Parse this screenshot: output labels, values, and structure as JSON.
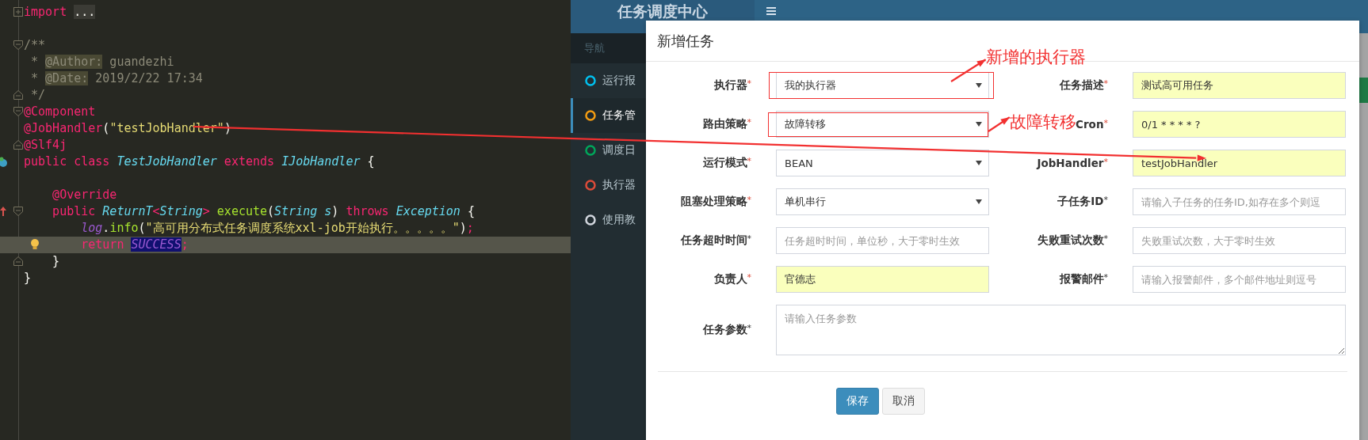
{
  "editor": {
    "lines": [
      {
        "current": false,
        "markers": [
          {
            "kind": "fold-plus"
          }
        ],
        "tokens": [
          {
            "t": "import ",
            "kind": "keyword"
          },
          {
            "t": "...",
            "kind": "folded"
          }
        ]
      },
      {
        "current": false
      },
      {
        "current": false,
        "markers": [
          {
            "kind": "fold-open"
          }
        ],
        "tokens": [
          {
            "t": "/**",
            "kind": "comment"
          }
        ]
      },
      {
        "current": false,
        "tokens": [
          {
            "t": " * ",
            "kind": "comment"
          },
          {
            "t": "@Author:",
            "kind": "doctag"
          },
          {
            "t": " guandezhi",
            "kind": "comment"
          }
        ]
      },
      {
        "current": false,
        "tokens": [
          {
            "t": " * ",
            "kind": "comment"
          },
          {
            "t": "@Date:",
            "kind": "doctag"
          },
          {
            "t": " 2019/2/22 17:34",
            "kind": "comment"
          }
        ]
      },
      {
        "current": false,
        "markers": [
          {
            "kind": "fold-close"
          }
        ],
        "tokens": [
          {
            "t": " */",
            "kind": "comment"
          }
        ]
      },
      {
        "current": false,
        "markers": [
          {
            "kind": "fold-open"
          }
        ],
        "tokens": [
          {
            "t": "@Component",
            "kind": "keyword"
          }
        ]
      },
      {
        "current": false,
        "tokens": [
          {
            "t": "@JobHandler",
            "kind": "keyword"
          },
          {
            "t": "(",
            "kind": "plain"
          },
          {
            "t": "\"testJobHandler\"",
            "kind": "string"
          },
          {
            "t": ")",
            "kind": "plain"
          }
        ]
      },
      {
        "current": false,
        "markers": [
          {
            "kind": "fold-close"
          }
        ],
        "tokens": [
          {
            "t": "@Slf4j",
            "kind": "keyword"
          }
        ]
      },
      {
        "current": false,
        "markers": [
          {
            "kind": "class"
          }
        ],
        "tokens": [
          {
            "t": "public class ",
            "kind": "keyword"
          },
          {
            "t": "TestJobHandler",
            "kind": "type"
          },
          {
            "t": " extends ",
            "kind": "keyword"
          },
          {
            "t": "IJobHandler",
            "kind": "type"
          },
          {
            "t": " {",
            "kind": "plain"
          }
        ]
      },
      {
        "current": false
      },
      {
        "current": false,
        "tokens": [
          {
            "t": "    @Override",
            "kind": "keyword"
          }
        ]
      },
      {
        "current": false,
        "markers": [
          {
            "kind": "override"
          },
          {
            "kind": "fold-open"
          }
        ],
        "tokens": [
          {
            "t": "    public ",
            "kind": "keyword"
          },
          {
            "t": "ReturnT",
            "kind": "type"
          },
          {
            "t": "<",
            "kind": "keyword"
          },
          {
            "t": "String",
            "kind": "type"
          },
          {
            "t": ">",
            "kind": "keyword"
          },
          {
            "t": " execute",
            "kind": "method"
          },
          {
            "t": "(",
            "kind": "plain"
          },
          {
            "t": "String s",
            "kind": "type"
          },
          {
            "t": ") ",
            "kind": "plain"
          },
          {
            "t": "throws ",
            "kind": "keyword"
          },
          {
            "t": "Exception",
            "kind": "type"
          },
          {
            "t": " {",
            "kind": "plain"
          }
        ]
      },
      {
        "current": false,
        "tokens": [
          {
            "t": "        log",
            "kind": "field"
          },
          {
            "t": ".",
            "kind": "plain"
          },
          {
            "t": "info",
            "kind": "method"
          },
          {
            "t": "(",
            "kind": "plain"
          },
          {
            "t": "\"高可用分布式任务调度系统xxl-job开始执行。。。。。\"",
            "kind": "string"
          },
          {
            "t": ")",
            "kind": "plain"
          },
          {
            "t": ";",
            "kind": "keyword"
          }
        ]
      },
      {
        "current": true,
        "markers": [
          {
            "kind": "bulb"
          }
        ],
        "tokens": [
          {
            "t": "        return ",
            "kind": "keyword"
          },
          {
            "t": "SUCCESS",
            "kind": "constant"
          },
          {
            "t": ";",
            "kind": "keyword"
          }
        ]
      },
      {
        "current": false,
        "markers": [
          {
            "kind": "fold-close"
          }
        ],
        "tokens": [
          {
            "t": "    }",
            "kind": "plain"
          }
        ]
      },
      {
        "current": false,
        "tokens": [
          {
            "t": "}",
            "kind": "plain"
          }
        ]
      }
    ]
  },
  "admin": {
    "brand": "任务调度中心",
    "nav_heading": "导航",
    "nav_items": [
      {
        "label": "运行报",
        "color": "#00c0ef",
        "selected": false
      },
      {
        "label": "任务管",
        "color": "#f39c12",
        "selected": true
      },
      {
        "label": "调度日",
        "color": "#00a65a",
        "selected": false
      },
      {
        "label": "执行器",
        "color": "#dd4b39",
        "selected": false
      },
      {
        "label": "使用教",
        "color": "#d2d6de",
        "selected": false
      }
    ]
  },
  "dialog": {
    "title": "新增任务",
    "fields": [
      {
        "label": "执行器",
        "mark": "*",
        "required": true,
        "kind": "select",
        "value": "我的执行器",
        "autofilled": false
      },
      {
        "label": "任务描述",
        "mark": "*",
        "required": true,
        "kind": "input",
        "value": "测试高可用任务",
        "autofilled": true
      },
      {
        "label": "路由策略",
        "mark": "*",
        "required": true,
        "kind": "select",
        "value": "故障转移",
        "autofilled": false
      },
      {
        "label": "Cron",
        "mark": "*",
        "required": true,
        "kind": "input",
        "value": "0/1 * * * * ?",
        "autofilled": true
      },
      {
        "label": "运行模式",
        "mark": "*",
        "required": true,
        "kind": "select",
        "value": "BEAN",
        "autofilled": false
      },
      {
        "label": "JobHandler",
        "mark": "*",
        "required": true,
        "kind": "input",
        "value": "testJobHandler",
        "autofilled": true
      },
      {
        "label": "阻塞处理策略",
        "mark": "*",
        "required": true,
        "kind": "select",
        "value": "单机串行",
        "autofilled": false
      },
      {
        "label": "子任务ID",
        "mark": "*",
        "required": false,
        "kind": "input",
        "placeholder": "请输入子任务的任务ID,如存在多个则逗",
        "autofilled": false
      },
      {
        "label": "任务超时时间",
        "mark": "*",
        "required": false,
        "kind": "input",
        "placeholder": "任务超时时间，单位秒，大于零时生效",
        "autofilled": false
      },
      {
        "label": "失败重试次数",
        "mark": "*",
        "required": false,
        "kind": "input",
        "placeholder": "失败重试次数，大于零时生效",
        "autofilled": false
      },
      {
        "label": "负责人",
        "mark": "*",
        "required": true,
        "kind": "input",
        "value": "官德志",
        "autofilled": true
      },
      {
        "label": "报警邮件",
        "mark": "*",
        "required": false,
        "kind": "input",
        "placeholder": "请输入报警邮件，多个邮件地址则逗号",
        "autofilled": false
      },
      {
        "label": "任务参数",
        "mark": "*",
        "required": false,
        "kind": "textarea",
        "placeholder": "请输入任务参数",
        "autofilled": false
      }
    ],
    "buttons": [
      {
        "label": "保存",
        "kind": "primary"
      },
      {
        "label": "取消",
        "kind": "default"
      }
    ]
  },
  "annotations": [
    {
      "text": "新增的执行器"
    },
    {
      "text": "故障转移"
    }
  ]
}
